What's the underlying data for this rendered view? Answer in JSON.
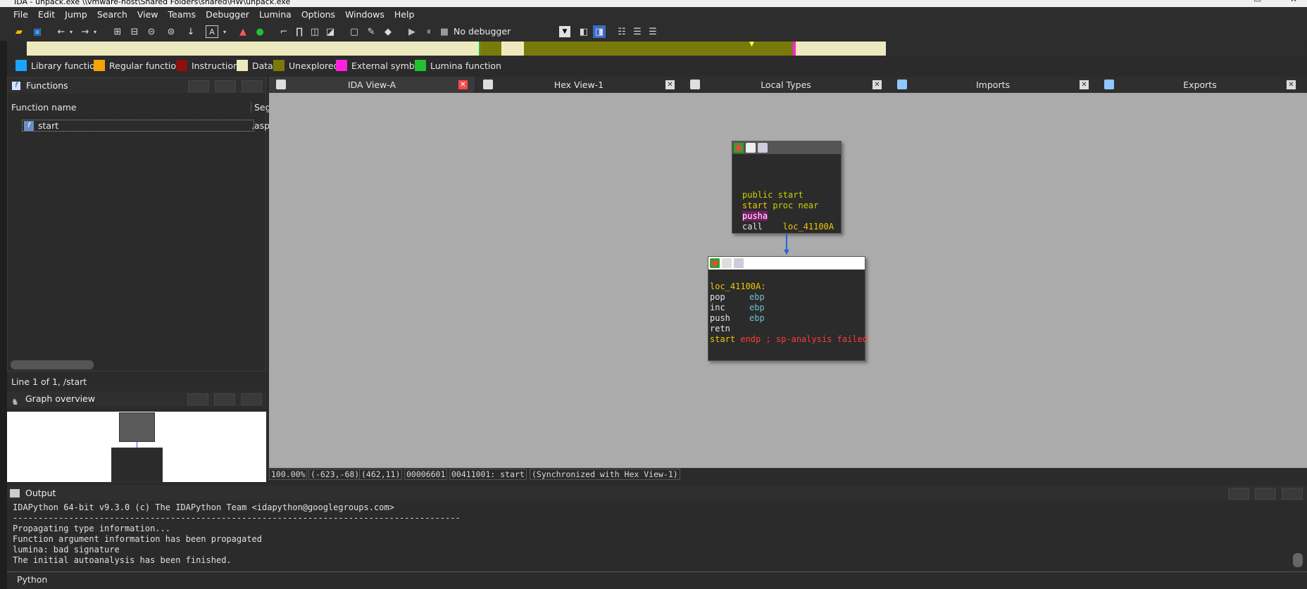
{
  "window": {
    "title": "IDA - unpack.exe \\\\vmware-host\\Shared Folders\\shared\\HW\\unpack.exe"
  },
  "menu": [
    "File",
    "Edit",
    "Jump",
    "Search",
    "View",
    "Teams",
    "Debugger",
    "Lumina",
    "Options",
    "Windows",
    "Help"
  ],
  "toolbar": {
    "debugger_select": "No debugger"
  },
  "legend": [
    {
      "label": "Library function",
      "color": "#1aa3ff"
    },
    {
      "label": "Regular function",
      "color": "#f5a300"
    },
    {
      "label": "Instruction",
      "color": "#8b1010"
    },
    {
      "label": "Data",
      "color": "#eeeac0"
    },
    {
      "label": "Unexplored",
      "color": "#7a7a0a"
    },
    {
      "label": "External symbol",
      "color": "#ff20e0"
    },
    {
      "label": "Lumina function",
      "color": "#22c033"
    }
  ],
  "functions_panel": {
    "title": "Functions",
    "col_name": "Function name",
    "col_seg": "Seg",
    "rows": [
      {
        "name": "start",
        "seg": ".asp"
      }
    ],
    "status": "Line 1 of 1, /start"
  },
  "graph_overview": {
    "title": "Graph overview"
  },
  "tabs": [
    {
      "label": "IDA View-A",
      "active": true
    },
    {
      "label": "Hex View-1",
      "active": false
    },
    {
      "label": "Local Types",
      "active": false
    },
    {
      "label": "Imports",
      "active": false
    },
    {
      "label": "Exports",
      "active": false
    }
  ],
  "node1": {
    "lines": [
      {
        "a": "public start",
        "b": ""
      },
      {
        "a": "start",
        "b": " proc near"
      },
      {
        "a": "pusha",
        "b": ""
      },
      {
        "a": "call    ",
        "b": "loc_41100A"
      }
    ]
  },
  "node2": {
    "label": "loc_41100A:",
    "lines": [
      {
        "op": "pop",
        "arg": "ebp"
      },
      {
        "op": "inc",
        "arg": "ebp"
      },
      {
        "op": "push",
        "arg": "ebp"
      },
      {
        "op": "retn",
        "arg": ""
      }
    ],
    "end_a": "start",
    "end_b": " endp ; sp-analysis failed"
  },
  "statusline": [
    "100.00%",
    "(-623,-68)",
    "(462,11)",
    "00006601",
    "00411001: start",
    "(Synchronized with Hex View-1)"
  ],
  "output": {
    "title": "Output",
    "lines": [
      "IDAPython 64-bit v9.3.0 (c) The IDAPython Team <idapython@googlegroups.com>",
      "---------------------------------------------------------------------------------------------",
      "Propagating type information...",
      "Function argument information has been propagated",
      "lumina: bad signature",
      "The initial autoanalysis has been finished."
    ]
  },
  "python_tab": "Python",
  "icons": [
    "open-icon",
    "save-icon",
    "back-icon",
    "forward-icon",
    "run-icon",
    "pause-icon",
    "stop-icon"
  ]
}
